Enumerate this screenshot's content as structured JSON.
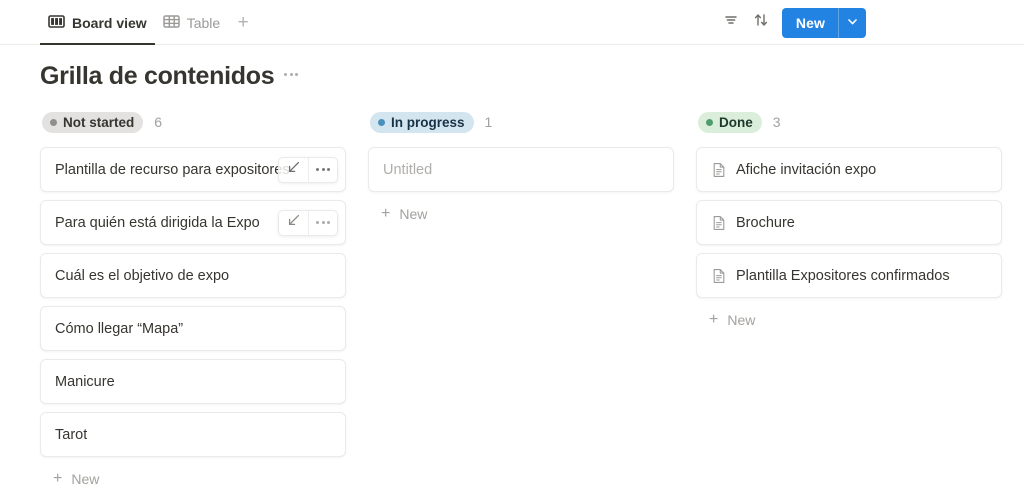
{
  "view_tabs": [
    {
      "label": "Board view",
      "icon": "board-view-icon",
      "active": true
    },
    {
      "label": "Table",
      "icon": "table-view-icon",
      "active": false
    }
  ],
  "tab_add": {
    "icon": "plus-icon",
    "label": "+"
  },
  "toolbar": {
    "filter_icon": "filter-icon",
    "sort_icon": "sort-icon",
    "search_icon": "search-icon",
    "expand_icon": "collapse-diagonal-icon",
    "more_icon": "more-options-icon",
    "new_label": "New",
    "new_chevron_icon": "chevron-down-icon",
    "new_color": "#2383E2"
  },
  "board": {
    "title": "Grilla de contenidos",
    "title_menu_icon": "more-options-icon",
    "new_item_label": "New",
    "columns": [
      {
        "status": "Not started",
        "count": "6",
        "dot_color": "#908F8B",
        "badge_bg": "#E3E2E0",
        "cards": [
          {
            "title": "Plantilla de recurso para expositores",
            "has_icon": false,
            "hovered": true
          },
          {
            "title": "Para quién está dirigida la Expo",
            "has_icon": false,
            "hovered": true
          },
          {
            "title": "Cuál es el objetivo de expo",
            "has_icon": false,
            "hovered": false
          },
          {
            "title": "Cómo llegar “Mapa”",
            "has_icon": false,
            "hovered": false
          },
          {
            "title": "Manicure",
            "has_icon": false,
            "hovered": false
          },
          {
            "title": "Tarot",
            "has_icon": false,
            "hovered": false
          }
        ]
      },
      {
        "status": "In progress",
        "count": "1",
        "dot_color": "#4A90BD",
        "badge_bg": "#D3E5EF",
        "cards": [
          {
            "title": "Untitled",
            "has_icon": false,
            "hovered": false,
            "placeholder": true
          }
        ]
      },
      {
        "status": "Done",
        "count": "3",
        "dot_color": "#4F9C6B",
        "badge_bg": "#DBEDDB",
        "cards": [
          {
            "title": "Afiche invitación expo",
            "has_icon": true,
            "hovered": false
          },
          {
            "title": "Brochure",
            "has_icon": true,
            "hovered": false
          },
          {
            "title": "Plantilla Expositores confirmados",
            "has_icon": true,
            "hovered": false
          }
        ]
      }
    ]
  }
}
